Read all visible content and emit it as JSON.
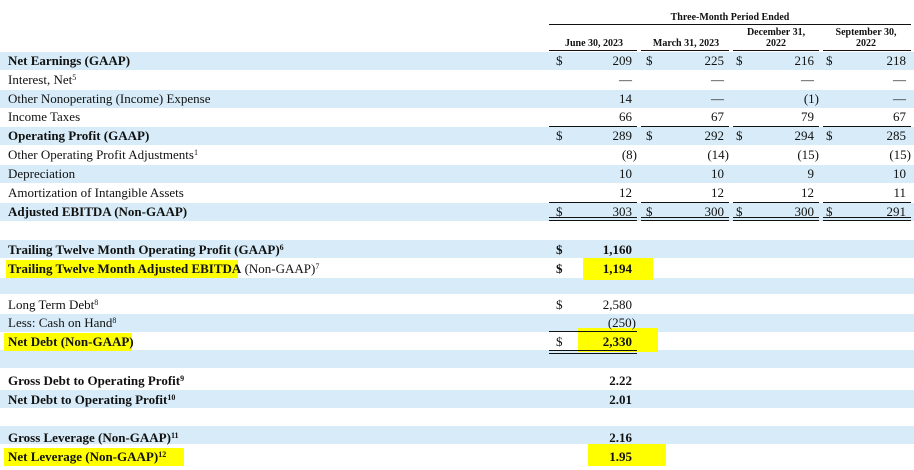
{
  "header": {
    "period_title": "Three-Month Period Ended",
    "columns": [
      "June 30, 2023",
      "March 31, 2023",
      "December 31,\n2022",
      "September 30,\n2022"
    ]
  },
  "currency_symbol": "$",
  "rows": [
    {
      "label": "Net Earnings (GAAP)",
      "sup": "",
      "bold": true,
      "dollars": true,
      "values": [
        "209",
        "225",
        "216",
        "218"
      ]
    },
    {
      "label": "Interest, Net",
      "sup": "5",
      "bold": false,
      "dollars": false,
      "values": [
        "—",
        "—",
        "—",
        "—"
      ]
    },
    {
      "label": "Other Nonoperating (Income) Expense",
      "sup": "",
      "bold": false,
      "dollars": false,
      "values": [
        "14",
        "—",
        "(1)",
        "—"
      ]
    },
    {
      "label": "Income Taxes",
      "sup": "",
      "bold": false,
      "dollars": false,
      "values": [
        "66",
        "67",
        "79",
        "67"
      ]
    },
    {
      "label": "Operating Profit (GAAP)",
      "sup": "",
      "bold": true,
      "dollars": true,
      "values": [
        "289",
        "292",
        "294",
        "285"
      ]
    },
    {
      "label": "Other Operating Profit Adjustments",
      "sup": "1",
      "bold": false,
      "dollars": false,
      "values": [
        "(8)",
        "(14)",
        "(15)",
        "(15)"
      ]
    },
    {
      "label": "Depreciation",
      "sup": "",
      "bold": false,
      "dollars": false,
      "values": [
        "10",
        "10",
        "9",
        "10"
      ]
    },
    {
      "label": "Amortization of Intangible Assets",
      "sup": "",
      "bold": false,
      "dollars": false,
      "values": [
        "12",
        "12",
        "12",
        "11"
      ]
    },
    {
      "label": "Adjusted EBITDA (Non-GAAP)",
      "sup": "",
      "bold": true,
      "dollars": true,
      "values": [
        "303",
        "300",
        "300",
        "291"
      ]
    }
  ],
  "ttm": [
    {
      "label": "Trailing Twelve Month Operating Profit (GAAP)",
      "sup": "6",
      "value": "1,160"
    },
    {
      "label_bold": "Trailing Twelve Month Adjusted EBITDA",
      "label_rest": " (Non-GAAP)",
      "sup": "7",
      "value": "1,194"
    }
  ],
  "debt": [
    {
      "label": "Long Term Debt",
      "sup": "8",
      "value": "2,580"
    },
    {
      "label": "Less: Cash on Hand",
      "sup": "8",
      "value": "(250)"
    },
    {
      "label": "Net Debt (Non-GAAP)",
      "sup": "",
      "value": "2,330"
    }
  ],
  "ratios": [
    {
      "label": "Gross Debt to Operating Profit",
      "sup": "9",
      "value": "2.22"
    },
    {
      "label": "Net Debt to Operating Profit",
      "sup": "10",
      "value": "2.01"
    }
  ],
  "leverage": [
    {
      "label": "Gross Leverage (Non-GAAP)",
      "sup": "11",
      "value": "2.16"
    },
    {
      "label": "Net Leverage (Non-GAAP)",
      "sup": "12",
      "value": "1.95"
    }
  ],
  "highlight_color": "#ffff00",
  "band_color": "#d7ecf8"
}
